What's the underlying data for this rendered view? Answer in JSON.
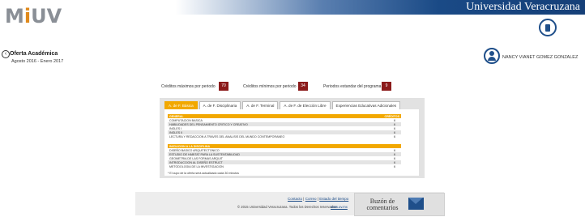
{
  "header": {
    "university": "Universidad Veracruzana",
    "logo_text_1": "M",
    "logo_dot": "i",
    "logo_text_2": "UV"
  },
  "page": {
    "title": "Oferta Académica",
    "period": "Agosto 2016 - Enero 2017"
  },
  "user": {
    "name": "NANCY VIANET GOMEZ GONZALEZ"
  },
  "credits": [
    {
      "label": "Créditos máximos por periodo",
      "value": "70"
    },
    {
      "label": "Créditos mínimos por periodo",
      "value": "34"
    },
    {
      "label": "Periodos estandar del programa",
      "value": "9"
    }
  ],
  "tabs": [
    "A. de F. Básica",
    "A. de F. Disciplinaria",
    "A. de F. Terminal",
    "A. de F. de Elección Libre",
    "Experiencias Educativas Adicionales"
  ],
  "section1": {
    "title": "GENERAL",
    "col": "CRÉDITOS",
    "rows": [
      {
        "name": "COMPUTACION BASICA",
        "credits": "6"
      },
      {
        "name": "HABILIDADES DEL PENSAMIENTO CRITICO Y CREATIVO",
        "credits": "6"
      },
      {
        "name": "INGLES I",
        "credits": "6"
      },
      {
        "name": "INGLES II",
        "credits": "6"
      },
      {
        "name": "LECTURA Y REDACCION A TRAVES DEL ANALISIS DEL MUNDO CONTEMPORANEO",
        "credits": "6"
      }
    ]
  },
  "section2": {
    "title": "INICIACION A LA DISCIPLINA",
    "rows": [
      {
        "name": "DISEÑO BASICO ARQUITECTONICO",
        "credits": "6"
      },
      {
        "name": "ESTUDIO DE HABITAT PARA LA SUSTENTABILIDAD",
        "credits": "6"
      },
      {
        "name": "GEOMETRIA DE LAS FORMAS ARQUIT",
        "credits": "6"
      },
      {
        "name": "INTRODUCCION AL DISEÑO ESTRUCT",
        "credits": "6"
      },
      {
        "name": "METODOLOGIA DE LA INVESTIGACION",
        "credits": "6"
      }
    ]
  },
  "note": "* El cupo de la oferta será actualizado cada 30 minutos",
  "footer": {
    "links": [
      "Contacto",
      "Correo",
      "Estado del tiempo"
    ],
    "separator": "|",
    "copyright": "© 2015 Universidad Veracruzana. Todos los Derechos reservados",
    "web": "www.uv.mx",
    "buzon": "Buzón de comentarios"
  }
}
